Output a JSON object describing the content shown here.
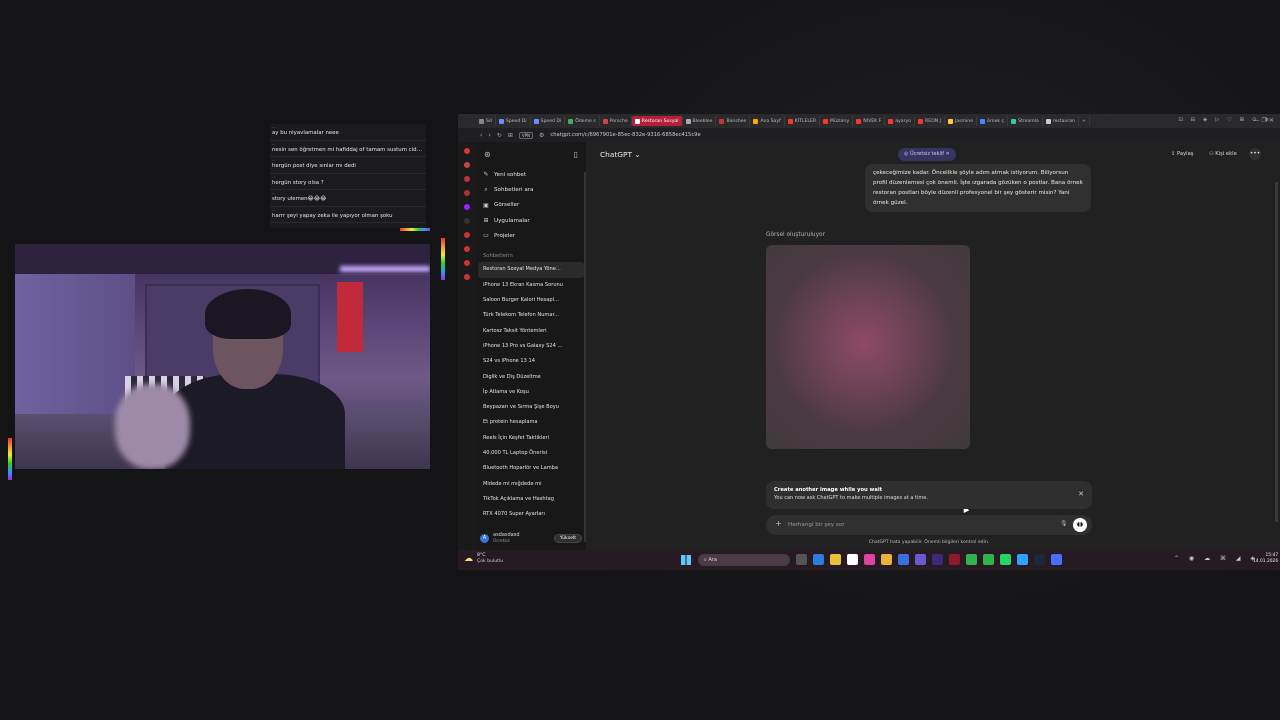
{
  "chat_overlay": {
    "messages": [
      {
        "text": "ay bu niyavlamalar neee"
      },
      {
        "text": "nesin sen öğretmen mi hafiddaj of tamam sustum ciddi okcam..."
      },
      {
        "text": "hergün post diye sınlar mı dedi"
      },
      {
        "text": "hergün story olsa ?"
      },
      {
        "text": "story ulemen😂😂😂"
      },
      {
        "text": "harrr şeyi yapay zeka ile yapıyor olman şoku"
      }
    ]
  },
  "browser": {
    "tabs": [
      {
        "label": "Sd",
        "color": "#888888"
      },
      {
        "label": "Speed Di",
        "color": "#6c8cff"
      },
      {
        "label": "Speed Di",
        "color": "#6c8cff"
      },
      {
        "label": "Ödeme s",
        "color": "#44aa66"
      },
      {
        "label": "Porsche",
        "color": "#cc4444"
      },
      {
        "label": "Restoran Sosyal",
        "color": "#ffffff",
        "active": true
      },
      {
        "label": "Bleeblee",
        "color": "#aaaaaa"
      },
      {
        "label": "Banshee",
        "color": "#cc3333"
      },
      {
        "label": "Ana Sayf",
        "color": "#ffaa00"
      },
      {
        "label": "KITLELER",
        "color": "#ff3333"
      },
      {
        "label": "Müzlarıy",
        "color": "#ff3333"
      },
      {
        "label": "NIVEK F",
        "color": "#ff3333"
      },
      {
        "label": "ayaryo",
        "color": "#ff3333"
      },
      {
        "label": "REON J",
        "color": "#ff3333"
      },
      {
        "label": "Jasmine",
        "color": "#ffcc33"
      },
      {
        "label": "örnek ç",
        "color": "#4488ff"
      },
      {
        "label": "Streamla",
        "color": "#33cc99"
      },
      {
        "label": "restauran",
        "color": "#cccccc"
      }
    ],
    "url": "chatgpt.com/c/6967901e-85ec-832e-9316-6858ec415c9e",
    "vpn": "VPN",
    "right_icons": "⊡ ⊟ ◈ ▷ ♡ ⊞ ⊙ ≡",
    "window_controls": "— ❐ ✕"
  },
  "sidebar": {
    "menu": [
      {
        "label": "Yeni sohbet",
        "icon": "✎",
        "name": "sidebar-new-chat"
      },
      {
        "label": "Sohbetleri ara",
        "icon": "⌕",
        "name": "sidebar-search-chats"
      },
      {
        "label": "Görseller",
        "icon": "▣",
        "name": "sidebar-images"
      },
      {
        "label": "Uygulamalar",
        "icon": "⊞",
        "name": "sidebar-apps"
      },
      {
        "label": "Projeler",
        "icon": "▭",
        "name": "sidebar-projects"
      }
    ],
    "section_title": "Sohbetlerin",
    "chats": [
      "Restoran Sosyal Medya Yöne...",
      "iPhone 13 Ekran Kasma Sorunu",
      "Saloon Burger Kalori Hesapl...",
      "Türk Telekom Telefon Numar...",
      "Kartosz Taksit Yöntemleri",
      "iPhone 13 Pro vs Galaxy S24 ...",
      "S24 vs iPhone 13 14",
      "Diglik ve Diş Düzeltme",
      "İp Atlama ve Koşu",
      "Beypazarı ve Sırma Şişe Boyu",
      "Et protein hesaplama",
      "Reels İçin Keşfet Taktikleri",
      "40.000 TL Laptop Önerisi",
      "Bluetooth Hoparlör ve Lamba",
      "Midede mi mığdede mi",
      "TikTok Açıklama ve Hashtag",
      "RTX 4070 Super Ayarları"
    ],
    "user": {
      "initial": "A",
      "name": "asdasdasd",
      "plan": "Ücretsiz",
      "upgrade": "Yükselt"
    }
  },
  "header": {
    "model": "ChatGPT ⌄",
    "free_offer": "◎ Ücretsiz teklif ✕",
    "share": "⇪ Paylaş",
    "add_person": "⚇ Kişi ekle",
    "more": "•••"
  },
  "conversation": {
    "user_message": "çekeceğimize kadar. Öncelikle şöyle adım atmak istiyorum. Biliyorsun profil düzenlemesi çok önemli. İşte ızgarada gözüken o postlar. Bana örnek restoran postları böyle düzenli profesyonel bir şey gösterir misin? Yani örnek güzel.",
    "generating_label": "Görsel oluşturuluyor"
  },
  "banner": {
    "title": "Create another image while you wait",
    "text": "You can now ask ChatGPT to make multiple images at a time.",
    "close": "✕"
  },
  "composer": {
    "plus": "+",
    "placeholder": "Herhangi bir şey sor",
    "mic": "🎙",
    "voice": "◖◗"
  },
  "disclaimer": "ChatGPT hata yapabilir. Önemli bilgileri kontrol edin.",
  "taskbar": {
    "weather_temp": "8°C",
    "weather_desc": "Çok bulutlu",
    "search": "⌕  Ara",
    "app_colors": [
      "#555555",
      "#2a7ee0",
      "#e8c33a",
      "#ffffff",
      "#e0439e",
      "#e8b33a",
      "#3a6fe0",
      "#6a5acd",
      "#3b2a7a",
      "#8b1a2a",
      "#2fb34a",
      "#2fb34a",
      "#25d366",
      "#2fa3ff",
      "#1b2838",
      "#4a6cff"
    ],
    "tray": "⌃ ◉ ☁ ⌘ ◢ ◈",
    "time": "15:47",
    "date": "14.01.2026"
  }
}
